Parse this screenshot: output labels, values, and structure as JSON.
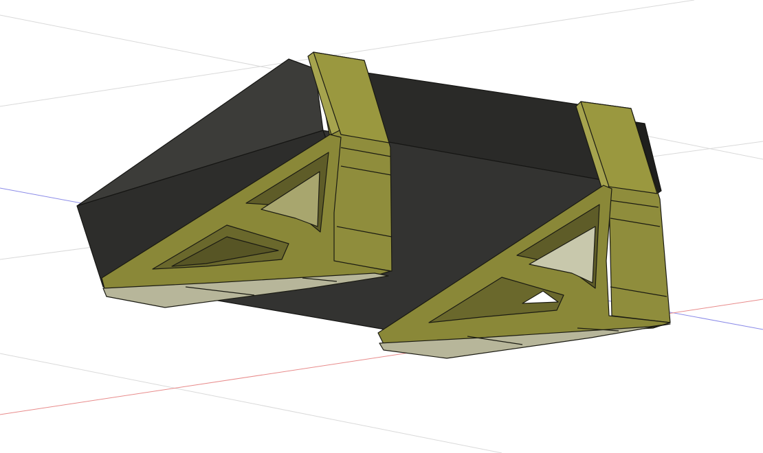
{
  "viewport": {
    "background": "#ffffff",
    "colors": {
      "axis_x": "#e88a8a",
      "axis_y": "#8a8ae8",
      "grid": "#d6d6d6",
      "body_dark_front": "#2b2b29",
      "body_dark_top": "#343432",
      "body_dark_side": "#3a3a37",
      "bracket_main": "#8e8c3a",
      "bracket_light": "#a4a24c",
      "bracket_shadow": "#6c6a2a",
      "bracket_face": "#b5b598",
      "bracket_face_light": "#c8c8ac",
      "edge": "#1a1a12"
    },
    "objects": [
      {
        "name": "rectangular-box",
        "kind": "dark-solid"
      },
      {
        "name": "left-bracket",
        "kind": "triangular-truss-bracket"
      },
      {
        "name": "right-bracket",
        "kind": "triangular-truss-bracket"
      }
    ]
  }
}
